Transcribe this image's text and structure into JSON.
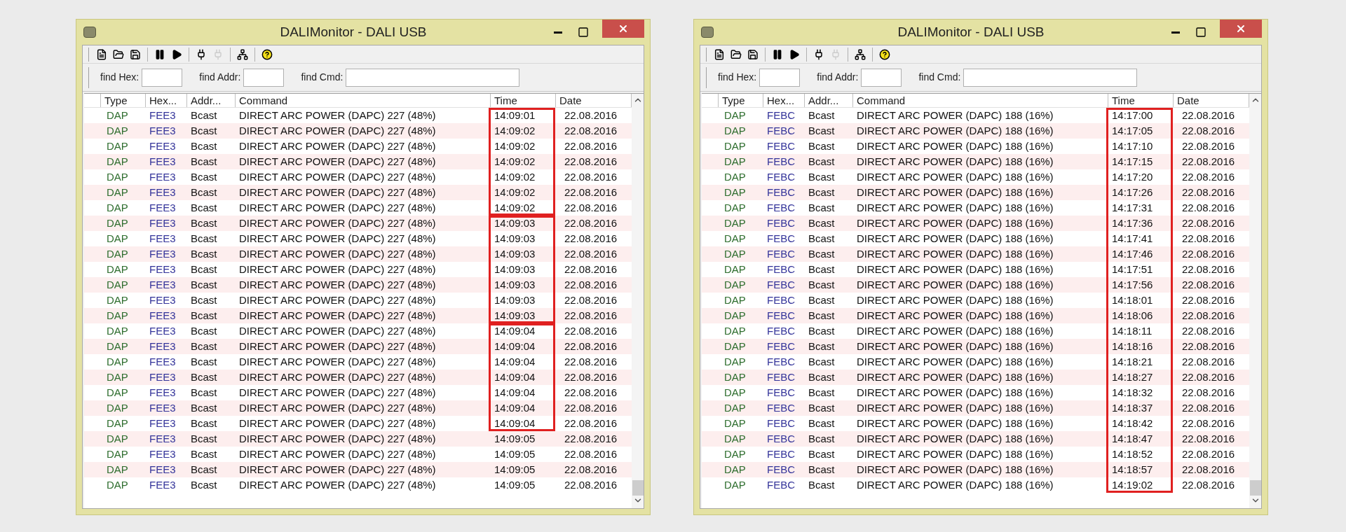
{
  "windows": [
    {
      "title": "DALIMonitor - DALI USB",
      "toolbar": [
        {
          "kind": "new",
          "disabled": false
        },
        {
          "kind": "open",
          "disabled": false
        },
        {
          "kind": "save",
          "disabled": false
        },
        {
          "kind": "pause",
          "disabled": false
        },
        {
          "kind": "play",
          "disabled": false
        },
        {
          "kind": "connect",
          "disabled": false
        },
        {
          "kind": "disconnect",
          "disabled": true
        },
        {
          "kind": "bus",
          "disabled": false
        },
        {
          "kind": "help",
          "disabled": false
        }
      ],
      "find_fields": [
        {
          "label": "find Hex:"
        },
        {
          "label": "find Addr:"
        },
        {
          "label": "find Cmd:"
        }
      ],
      "columns": [
        "Type",
        "Hex...",
        "Addr...",
        "Command",
        "Time",
        "Date"
      ],
      "row_groups": [
        {
          "outlined": true,
          "rows": [
            {
              "type": "DAP",
              "hex": "FEE3",
              "addr": "Bcast",
              "command": "DIRECT ARC POWER (DAPC) 227 (48%)",
              "time": "14:09:01",
              "date": "22.08.2016"
            },
            {
              "type": "DAP",
              "hex": "FEE3",
              "addr": "Bcast",
              "command": "DIRECT ARC POWER (DAPC) 227 (48%)",
              "time": "14:09:02",
              "date": "22.08.2016"
            },
            {
              "type": "DAP",
              "hex": "FEE3",
              "addr": "Bcast",
              "command": "DIRECT ARC POWER (DAPC) 227 (48%)",
              "time": "14:09:02",
              "date": "22.08.2016"
            },
            {
              "type": "DAP",
              "hex": "FEE3",
              "addr": "Bcast",
              "command": "DIRECT ARC POWER (DAPC) 227 (48%)",
              "time": "14:09:02",
              "date": "22.08.2016"
            },
            {
              "type": "DAP",
              "hex": "FEE3",
              "addr": "Bcast",
              "command": "DIRECT ARC POWER (DAPC) 227 (48%)",
              "time": "14:09:02",
              "date": "22.08.2016"
            },
            {
              "type": "DAP",
              "hex": "FEE3",
              "addr": "Bcast",
              "command": "DIRECT ARC POWER (DAPC) 227 (48%)",
              "time": "14:09:02",
              "date": "22.08.2016"
            },
            {
              "type": "DAP",
              "hex": "FEE3",
              "addr": "Bcast",
              "command": "DIRECT ARC POWER (DAPC) 227 (48%)",
              "time": "14:09:02",
              "date": "22.08.2016"
            }
          ]
        },
        {
          "outlined": true,
          "rows": [
            {
              "type": "DAP",
              "hex": "FEE3",
              "addr": "Bcast",
              "command": "DIRECT ARC POWER (DAPC) 227 (48%)",
              "time": "14:09:03",
              "date": "22.08.2016"
            },
            {
              "type": "DAP",
              "hex": "FEE3",
              "addr": "Bcast",
              "command": "DIRECT ARC POWER (DAPC) 227 (48%)",
              "time": "14:09:03",
              "date": "22.08.2016"
            },
            {
              "type": "DAP",
              "hex": "FEE3",
              "addr": "Bcast",
              "command": "DIRECT ARC POWER (DAPC) 227 (48%)",
              "time": "14:09:03",
              "date": "22.08.2016"
            },
            {
              "type": "DAP",
              "hex": "FEE3",
              "addr": "Bcast",
              "command": "DIRECT ARC POWER (DAPC) 227 (48%)",
              "time": "14:09:03",
              "date": "22.08.2016"
            },
            {
              "type": "DAP",
              "hex": "FEE3",
              "addr": "Bcast",
              "command": "DIRECT ARC POWER (DAPC) 227 (48%)",
              "time": "14:09:03",
              "date": "22.08.2016"
            },
            {
              "type": "DAP",
              "hex": "FEE3",
              "addr": "Bcast",
              "command": "DIRECT ARC POWER (DAPC) 227 (48%)",
              "time": "14:09:03",
              "date": "22.08.2016"
            },
            {
              "type": "DAP",
              "hex": "FEE3",
              "addr": "Bcast",
              "command": "DIRECT ARC POWER (DAPC) 227 (48%)",
              "time": "14:09:03",
              "date": "22.08.2016"
            }
          ]
        },
        {
          "outlined": true,
          "rows": [
            {
              "type": "DAP",
              "hex": "FEE3",
              "addr": "Bcast",
              "command": "DIRECT ARC POWER (DAPC) 227 (48%)",
              "time": "14:09:04",
              "date": "22.08.2016"
            },
            {
              "type": "DAP",
              "hex": "FEE3",
              "addr": "Bcast",
              "command": "DIRECT ARC POWER (DAPC) 227 (48%)",
              "time": "14:09:04",
              "date": "22.08.2016"
            },
            {
              "type": "DAP",
              "hex": "FEE3",
              "addr": "Bcast",
              "command": "DIRECT ARC POWER (DAPC) 227 (48%)",
              "time": "14:09:04",
              "date": "22.08.2016"
            },
            {
              "type": "DAP",
              "hex": "FEE3",
              "addr": "Bcast",
              "command": "DIRECT ARC POWER (DAPC) 227 (48%)",
              "time": "14:09:04",
              "date": "22.08.2016"
            },
            {
              "type": "DAP",
              "hex": "FEE3",
              "addr": "Bcast",
              "command": "DIRECT ARC POWER (DAPC) 227 (48%)",
              "time": "14:09:04",
              "date": "22.08.2016"
            },
            {
              "type": "DAP",
              "hex": "FEE3",
              "addr": "Bcast",
              "command": "DIRECT ARC POWER (DAPC) 227 (48%)",
              "time": "14:09:04",
              "date": "22.08.2016"
            },
            {
              "type": "DAP",
              "hex": "FEE3",
              "addr": "Bcast",
              "command": "DIRECT ARC POWER (DAPC) 227 (48%)",
              "time": "14:09:04",
              "date": "22.08.2016"
            }
          ]
        },
        {
          "outlined": false,
          "rows": [
            {
              "type": "DAP",
              "hex": "FEE3",
              "addr": "Bcast",
              "command": "DIRECT ARC POWER (DAPC) 227 (48%)",
              "time": "14:09:05",
              "date": "22.08.2016"
            },
            {
              "type": "DAP",
              "hex": "FEE3",
              "addr": "Bcast",
              "command": "DIRECT ARC POWER (DAPC) 227 (48%)",
              "time": "14:09:05",
              "date": "22.08.2016"
            },
            {
              "type": "DAP",
              "hex": "FEE3",
              "addr": "Bcast",
              "command": "DIRECT ARC POWER (DAPC) 227 (48%)",
              "time": "14:09:05",
              "date": "22.08.2016"
            },
            {
              "type": "DAP",
              "hex": "FEE3",
              "addr": "Bcast",
              "command": "DIRECT ARC POWER (DAPC) 227 (48%)",
              "time": "14:09:05",
              "date": "22.08.2016"
            }
          ]
        }
      ]
    },
    {
      "title": "DALIMonitor - DALI USB",
      "toolbar": [
        {
          "kind": "new",
          "disabled": false
        },
        {
          "kind": "open",
          "disabled": false
        },
        {
          "kind": "save",
          "disabled": false
        },
        {
          "kind": "pause",
          "disabled": false
        },
        {
          "kind": "play",
          "disabled": false
        },
        {
          "kind": "connect",
          "disabled": false
        },
        {
          "kind": "disconnect",
          "disabled": true
        },
        {
          "kind": "bus",
          "disabled": false
        },
        {
          "kind": "help",
          "disabled": false
        }
      ],
      "find_fields": [
        {
          "label": "find Hex:"
        },
        {
          "label": "find Addr:"
        },
        {
          "label": "find Cmd:"
        }
      ],
      "columns": [
        "Type",
        "Hex...",
        "Addr...",
        "Command",
        "Time",
        "Date"
      ],
      "row_groups": [
        {
          "outlined": true,
          "rows": [
            {
              "type": "DAP",
              "hex": "FEBC",
              "addr": "Bcast",
              "command": "DIRECT ARC POWER (DAPC) 188 (16%)",
              "time": "14:17:00",
              "date": "22.08.2016"
            },
            {
              "type": "DAP",
              "hex": "FEBC",
              "addr": "Bcast",
              "command": "DIRECT ARC POWER (DAPC) 188 (16%)",
              "time": "14:17:05",
              "date": "22.08.2016"
            },
            {
              "type": "DAP",
              "hex": "FEBC",
              "addr": "Bcast",
              "command": "DIRECT ARC POWER (DAPC) 188 (16%)",
              "time": "14:17:10",
              "date": "22.08.2016"
            },
            {
              "type": "DAP",
              "hex": "FEBC",
              "addr": "Bcast",
              "command": "DIRECT ARC POWER (DAPC) 188 (16%)",
              "time": "14:17:15",
              "date": "22.08.2016"
            },
            {
              "type": "DAP",
              "hex": "FEBC",
              "addr": "Bcast",
              "command": "DIRECT ARC POWER (DAPC) 188 (16%)",
              "time": "14:17:20",
              "date": "22.08.2016"
            },
            {
              "type": "DAP",
              "hex": "FEBC",
              "addr": "Bcast",
              "command": "DIRECT ARC POWER (DAPC) 188 (16%)",
              "time": "14:17:26",
              "date": "22.08.2016"
            },
            {
              "type": "DAP",
              "hex": "FEBC",
              "addr": "Bcast",
              "command": "DIRECT ARC POWER (DAPC) 188 (16%)",
              "time": "14:17:31",
              "date": "22.08.2016"
            },
            {
              "type": "DAP",
              "hex": "FEBC",
              "addr": "Bcast",
              "command": "DIRECT ARC POWER (DAPC) 188 (16%)",
              "time": "14:17:36",
              "date": "22.08.2016"
            },
            {
              "type": "DAP",
              "hex": "FEBC",
              "addr": "Bcast",
              "command": "DIRECT ARC POWER (DAPC) 188 (16%)",
              "time": "14:17:41",
              "date": "22.08.2016"
            },
            {
              "type": "DAP",
              "hex": "FEBC",
              "addr": "Bcast",
              "command": "DIRECT ARC POWER (DAPC) 188 (16%)",
              "time": "14:17:46",
              "date": "22.08.2016"
            },
            {
              "type": "DAP",
              "hex": "FEBC",
              "addr": "Bcast",
              "command": "DIRECT ARC POWER (DAPC) 188 (16%)",
              "time": "14:17:51",
              "date": "22.08.2016"
            },
            {
              "type": "DAP",
              "hex": "FEBC",
              "addr": "Bcast",
              "command": "DIRECT ARC POWER (DAPC) 188 (16%)",
              "time": "14:17:56",
              "date": "22.08.2016"
            },
            {
              "type": "DAP",
              "hex": "FEBC",
              "addr": "Bcast",
              "command": "DIRECT ARC POWER (DAPC) 188 (16%)",
              "time": "14:18:01",
              "date": "22.08.2016"
            },
            {
              "type": "DAP",
              "hex": "FEBC",
              "addr": "Bcast",
              "command": "DIRECT ARC POWER (DAPC) 188 (16%)",
              "time": "14:18:06",
              "date": "22.08.2016"
            },
            {
              "type": "DAP",
              "hex": "FEBC",
              "addr": "Bcast",
              "command": "DIRECT ARC POWER (DAPC) 188 (16%)",
              "time": "14:18:11",
              "date": "22.08.2016"
            },
            {
              "type": "DAP",
              "hex": "FEBC",
              "addr": "Bcast",
              "command": "DIRECT ARC POWER (DAPC) 188 (16%)",
              "time": "14:18:16",
              "date": "22.08.2016"
            },
            {
              "type": "DAP",
              "hex": "FEBC",
              "addr": "Bcast",
              "command": "DIRECT ARC POWER (DAPC) 188 (16%)",
              "time": "14:18:21",
              "date": "22.08.2016"
            },
            {
              "type": "DAP",
              "hex": "FEBC",
              "addr": "Bcast",
              "command": "DIRECT ARC POWER (DAPC) 188 (16%)",
              "time": "14:18:27",
              "date": "22.08.2016"
            },
            {
              "type": "DAP",
              "hex": "FEBC",
              "addr": "Bcast",
              "command": "DIRECT ARC POWER (DAPC) 188 (16%)",
              "time": "14:18:32",
              "date": "22.08.2016"
            },
            {
              "type": "DAP",
              "hex": "FEBC",
              "addr": "Bcast",
              "command": "DIRECT ARC POWER (DAPC) 188 (16%)",
              "time": "14:18:37",
              "date": "22.08.2016"
            },
            {
              "type": "DAP",
              "hex": "FEBC",
              "addr": "Bcast",
              "command": "DIRECT ARC POWER (DAPC) 188 (16%)",
              "time": "14:18:42",
              "date": "22.08.2016"
            },
            {
              "type": "DAP",
              "hex": "FEBC",
              "addr": "Bcast",
              "command": "DIRECT ARC POWER (DAPC) 188 (16%)",
              "time": "14:18:47",
              "date": "22.08.2016"
            },
            {
              "type": "DAP",
              "hex": "FEBC",
              "addr": "Bcast",
              "command": "DIRECT ARC POWER (DAPC) 188 (16%)",
              "time": "14:18:52",
              "date": "22.08.2016"
            },
            {
              "type": "DAP",
              "hex": "FEBC",
              "addr": "Bcast",
              "command": "DIRECT ARC POWER (DAPC) 188 (16%)",
              "time": "14:18:57",
              "date": "22.08.2016"
            },
            {
              "type": "DAP",
              "hex": "FEBC",
              "addr": "Bcast",
              "command": "DIRECT ARC POWER (DAPC) 188 (16%)",
              "time": "14:19:02",
              "date": "22.08.2016"
            }
          ]
        }
      ]
    }
  ]
}
